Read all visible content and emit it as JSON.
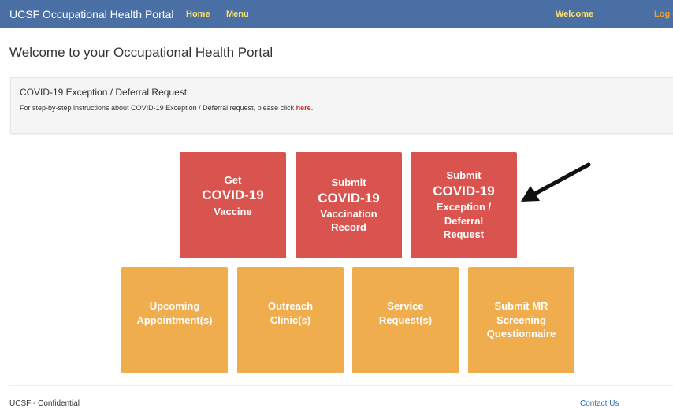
{
  "navbar": {
    "brand": "UCSF Occupational Health Portal",
    "home": "Home",
    "menu": "Menu",
    "welcome": "Welcome",
    "logoff": "Log of"
  },
  "page": {
    "title": "Welcome to your Occupational Health Portal"
  },
  "info_panel": {
    "heading": "COVID-19 Exception / Deferral Request",
    "text": "For step-by-step instructions about COVID-19 Exception / Deferral request, please click",
    "link": "here",
    "period": "."
  },
  "tiles_row1": [
    {
      "line1": "Get",
      "line2": "COVID-19",
      "line3": "Vaccine",
      "line4": ""
    },
    {
      "line1": "Submit",
      "line2": "COVID-19",
      "line3": "Vaccination",
      "line4": "Record"
    },
    {
      "line1": "Submit",
      "line2": "COVID-19",
      "line3": "Exception /",
      "line4": "Deferral",
      "line5": "Request"
    }
  ],
  "tiles_row2": [
    {
      "line1": "Upcoming",
      "line2": "Appointment(s)"
    },
    {
      "line1": "Outreach",
      "line2": "Clinic(s)"
    },
    {
      "line1": "Service",
      "line2": "Request(s)"
    },
    {
      "line1": "Submit MR",
      "line2": "Screening",
      "line3": "Questionnaire"
    }
  ],
  "footer": {
    "left": "UCSF - Confidential",
    "right": "Contact Us"
  },
  "colors": {
    "navbar": "#4a6fa5",
    "tile_red": "#d9534f",
    "tile_orange": "#f0ad4e",
    "link_red": "#c0392b"
  }
}
